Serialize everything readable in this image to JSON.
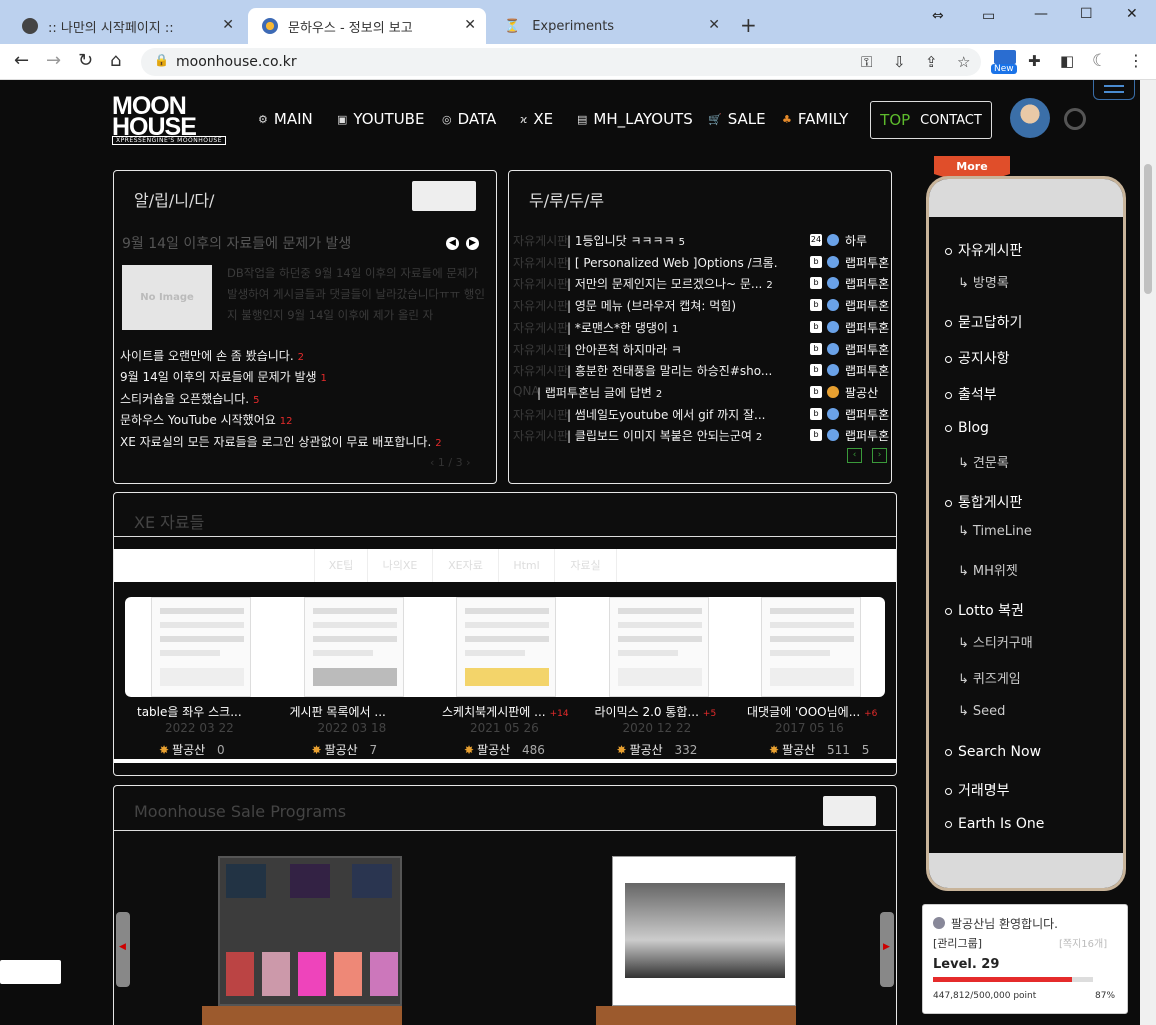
{
  "browser": {
    "tabs": [
      {
        "title": ":: 나만의 시작페이지 ::",
        "icon": "globe-icon"
      },
      {
        "title": "문하우스 - 정보의 보고",
        "icon": "site-favicon"
      },
      {
        "title": "Experiments",
        "icon": "flask-icon"
      }
    ],
    "url": "moonhouse.co.kr",
    "new_badge": "New"
  },
  "site": {
    "logo_line1": "MOON",
    "logo_line2": "HOUSE",
    "logo_sub": "XPRESSENGINE'S MOONHOUSE",
    "nav": [
      {
        "label": "MAIN",
        "icon": "gear-icon"
      },
      {
        "label": "YOUTUBE",
        "icon": "video-icon"
      },
      {
        "label": "DATA",
        "icon": "database-icon"
      },
      {
        "label": "XE",
        "icon": "xe-icon"
      },
      {
        "label": "MH_LAYOUTS",
        "icon": "layout-icon"
      },
      {
        "label": "SALE",
        "icon": "cart-icon"
      },
      {
        "label": "FAMILY",
        "icon": "family-icon"
      }
    ],
    "contact_top": "TOP",
    "contact_label": "CONTACT"
  },
  "notice": {
    "title": "알/립/니/다/",
    "featured_title": "9월 14일 이후의 자료들에 문제가 발생",
    "no_image": "No Image",
    "featured_text": "DB작업을 하던중 9월 14일 이후의 자료들에 문제가 발생하여 게시글들과 댓글들이 날라갔습니다ㅠㅠ 행인지 불행인지 9월 14일 이후에 제가 올린 자",
    "items": [
      {
        "text": "사이트를 오랜만에 손 좀 봤습니다.",
        "count": "2"
      },
      {
        "text": "9월 14일 이후의 자료들에 문제가 발생",
        "count": "1"
      },
      {
        "text": "스티커숍을 오픈했습니다.",
        "count": "5"
      },
      {
        "text": "문하우스 YouTube 시작했어요",
        "count": "12"
      },
      {
        "text": "XE 자료실의 모든 자료들을 로그인 상관없이 무료 배포합니다.",
        "count": "2"
      }
    ],
    "pager": "1 / 3"
  },
  "board": {
    "title": "두/루/두/루",
    "rows": [
      {
        "cat": "자유게시판",
        "text": "1등입니닷 ㅋㅋㅋㅋ",
        "count": "5",
        "user": "하루"
      },
      {
        "cat": "자유게시판",
        "text": "[ Personalized Web ]Options /크롬...",
        "count": "2",
        "user": "랩퍼투혼"
      },
      {
        "cat": "자유게시판",
        "text": "저만의 문제인지는 모르겠으나~ 문...",
        "count": "2",
        "user": "랩퍼투혼"
      },
      {
        "cat": "자유게시판",
        "text": "영문 메뉴 (브라우저 캡쳐: 먹힘)",
        "count": "",
        "user": "랩퍼투혼"
      },
      {
        "cat": "자유게시판",
        "text": "*로맨스*한 댕댕이",
        "count": "1",
        "user": "랩퍼투혼"
      },
      {
        "cat": "자유게시판",
        "text": "안아픈척 하지마라 ㅋ",
        "count": "",
        "user": "랩퍼투혼"
      },
      {
        "cat": "자유게시판",
        "text": "흥분한 전태풍을 말리는 하승진#sho...",
        "count": "",
        "user": "랩퍼투혼"
      },
      {
        "cat": "QNA",
        "text": "랩퍼투혼님 글에 답변",
        "count": "2",
        "user": "팔공산"
      },
      {
        "cat": "자유게시판",
        "text": "썸네일도youtube 에서 gif 까지 잘...",
        "count": "",
        "user": "랩퍼투혼"
      },
      {
        "cat": "자유게시판",
        "text": "클립보드 이미지 복붙은 안되는군여",
        "count": "2",
        "user": "랩퍼투혼"
      }
    ]
  },
  "xe": {
    "title": "XE 자료들",
    "tabs": [
      "XE팁",
      "나의XE",
      "XE자료",
      "Html",
      "자료실"
    ],
    "cards": [
      {
        "title": "table을 좌우 스크...",
        "extra": "",
        "date": "2022 03 22",
        "user": "팔공산",
        "views": "0",
        "comments": ""
      },
      {
        "title": "게시판 목록에서 ...",
        "extra": "",
        "date": "2022 03 18",
        "user": "팔공산",
        "views": "7",
        "comments": ""
      },
      {
        "title": "스케치북게시판에 ...",
        "extra": "+14",
        "date": "2021 05 26",
        "user": "팔공산",
        "views": "486",
        "comments": ""
      },
      {
        "title": "라이믹스 2.0 통합...",
        "extra": "+5",
        "date": "2020 12 22",
        "user": "팔공산",
        "views": "332",
        "comments": ""
      },
      {
        "title": "대댓글에 'OOO님에...",
        "extra": "+6",
        "date": "2017 05 16",
        "user": "팔공산",
        "views": "511",
        "comments": "5"
      }
    ]
  },
  "sale": {
    "title": "Moonhouse Sale Programs"
  },
  "menu": {
    "more": "More",
    "items": [
      {
        "label": "자유게시판",
        "sub": false
      },
      {
        "label": "방명록",
        "sub": true
      },
      {
        "label": "묻고답하기",
        "sub": false
      },
      {
        "label": "공지사항",
        "sub": false
      },
      {
        "label": "출석부",
        "sub": false
      },
      {
        "label": "Blog",
        "sub": false
      },
      {
        "label": "견문록",
        "sub": true
      },
      {
        "label": "통합게시판",
        "sub": false
      },
      {
        "label": "TimeLine",
        "sub": true
      },
      {
        "label": "MH위젯",
        "sub": true
      },
      {
        "label": "Lotto 복권",
        "sub": false
      },
      {
        "label": "스티커구매",
        "sub": true
      },
      {
        "label": "퀴즈게임",
        "sub": true
      },
      {
        "label": "Seed",
        "sub": true
      },
      {
        "label": "Search Now",
        "sub": false
      },
      {
        "label": "거래명부",
        "sub": false
      },
      {
        "label": "Earth Is One",
        "sub": false
      }
    ]
  },
  "login": {
    "welcome": "팔공산님 환영합니다.",
    "group": "[관리그룹]",
    "right_tag": "[쪽지16개]",
    "level": "Level. 29",
    "points": "447,812/500,000 point",
    "percent": "87%",
    "progress": 0.87
  }
}
